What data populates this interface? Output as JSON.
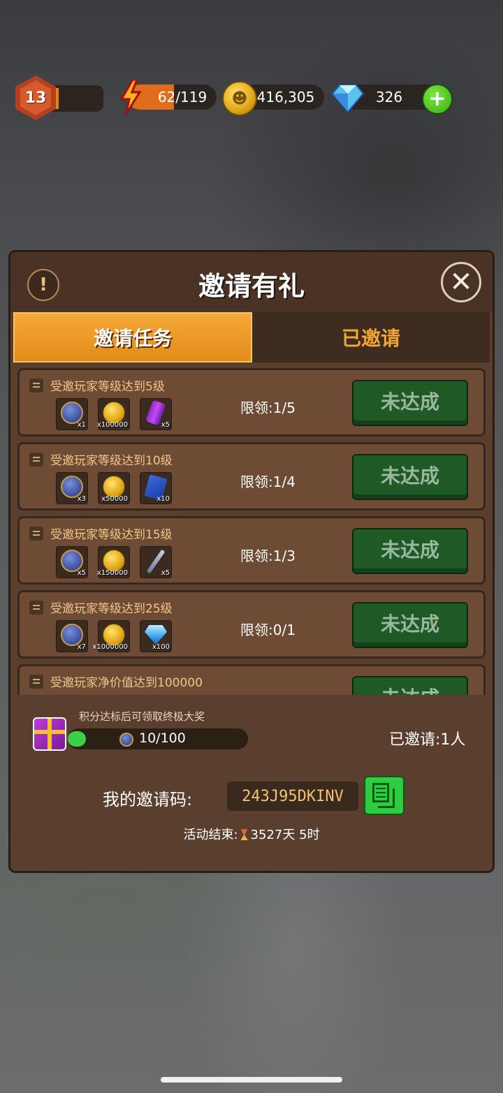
{
  "topbar": {
    "level": "13",
    "energy": "62/119",
    "energy_fraction": 0.52,
    "gold": "416,305",
    "gems": "326",
    "add_label": "+"
  },
  "panel": {
    "title": "邀请有礼",
    "info_icon": "!",
    "close_icon": "✕",
    "tabs": [
      {
        "label": "邀请任务",
        "active": true
      },
      {
        "label": "已邀请",
        "active": false
      }
    ],
    "tasks": [
      {
        "title": "受邀玩家等级达到5级",
        "limit": "限领:1/5",
        "button": "未达成",
        "rewards": [
          {
            "icon": "player-token-icon",
            "qty": "x1"
          },
          {
            "icon": "gold-coin-icon",
            "qty": "x100000"
          },
          {
            "icon": "energy-drink-icon",
            "qty": "x5"
          }
        ]
      },
      {
        "title": "受邀玩家等级达到10级",
        "limit": "限领:1/4",
        "button": "未达成",
        "rewards": [
          {
            "icon": "player-token-icon",
            "qty": "x3"
          },
          {
            "icon": "gold-coin-icon",
            "qty": "x50000"
          },
          {
            "icon": "skill-card-icon",
            "qty": "x10"
          }
        ]
      },
      {
        "title": "受邀玩家等级达到15级",
        "limit": "限领:1/3",
        "button": "未达成",
        "rewards": [
          {
            "icon": "player-token-icon",
            "qty": "x5"
          },
          {
            "icon": "gold-coin-icon",
            "qty": "x150000"
          },
          {
            "icon": "syringe-icon",
            "qty": "x5"
          }
        ]
      },
      {
        "title": "受邀玩家等级达到25级",
        "limit": "限领:0/1",
        "button": "未达成",
        "rewards": [
          {
            "icon": "player-token-icon",
            "qty": "x7"
          },
          {
            "icon": "gold-coin-icon",
            "qty": "x1000000"
          },
          {
            "icon": "diamond-icon",
            "qty": "x100"
          }
        ]
      },
      {
        "title": "受邀玩家净价值达到100000",
        "limit": "",
        "button": "未达成",
        "rewards": []
      }
    ],
    "score_hint": "积分达标后可领取终极大奖",
    "score_text": "10/100",
    "score_fraction": 0.1,
    "invited_count": "已邀请:1人",
    "code_label": "我的邀请码:",
    "invite_code": "243J95DKINV",
    "end_prefix": "活动结束:",
    "end_time": "3527天 5时"
  },
  "colors": {
    "tab_active": "#e28b18",
    "button_green": "#1f5a26",
    "panel_bg": "#5a3f2e"
  }
}
